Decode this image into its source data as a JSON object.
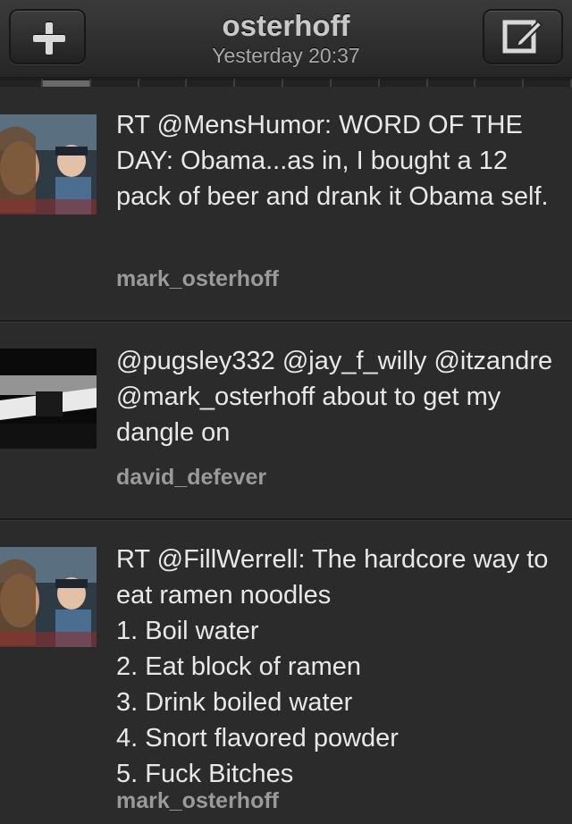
{
  "header": {
    "title": "osterhoff",
    "subtitle": "Yesterday 20:37",
    "left_icon": "plus-icon",
    "right_icon": "compose-icon"
  },
  "tweets": [
    {
      "text": "RT @MensHumor: WORD OF THE DAY: Obama...as in, I bought a 12 pack of beer and drank it Obama self.",
      "user": "mark_osterhoff",
      "avatar": "photo-avatar"
    },
    {
      "text": "@pugsley332 @jay_f_willy @itzandre @mark_osterhoff about to get my dangle on",
      "user": "david_defever",
      "avatar": "photo-avatar"
    },
    {
      "text": "RT @FillWerrell: The hardcore way to eat ramen noodles\n1. Boil water\n2. Eat block of ramen\n3. Drink boiled water\n4. Snort flavored powder\n5. Fuck Bitches",
      "user": "mark_osterhoff",
      "avatar": "photo-avatar"
    }
  ],
  "colors": {
    "background": "#2b2b2b",
    "text": "#e8e8e8",
    "username": "#9a9a9a"
  }
}
